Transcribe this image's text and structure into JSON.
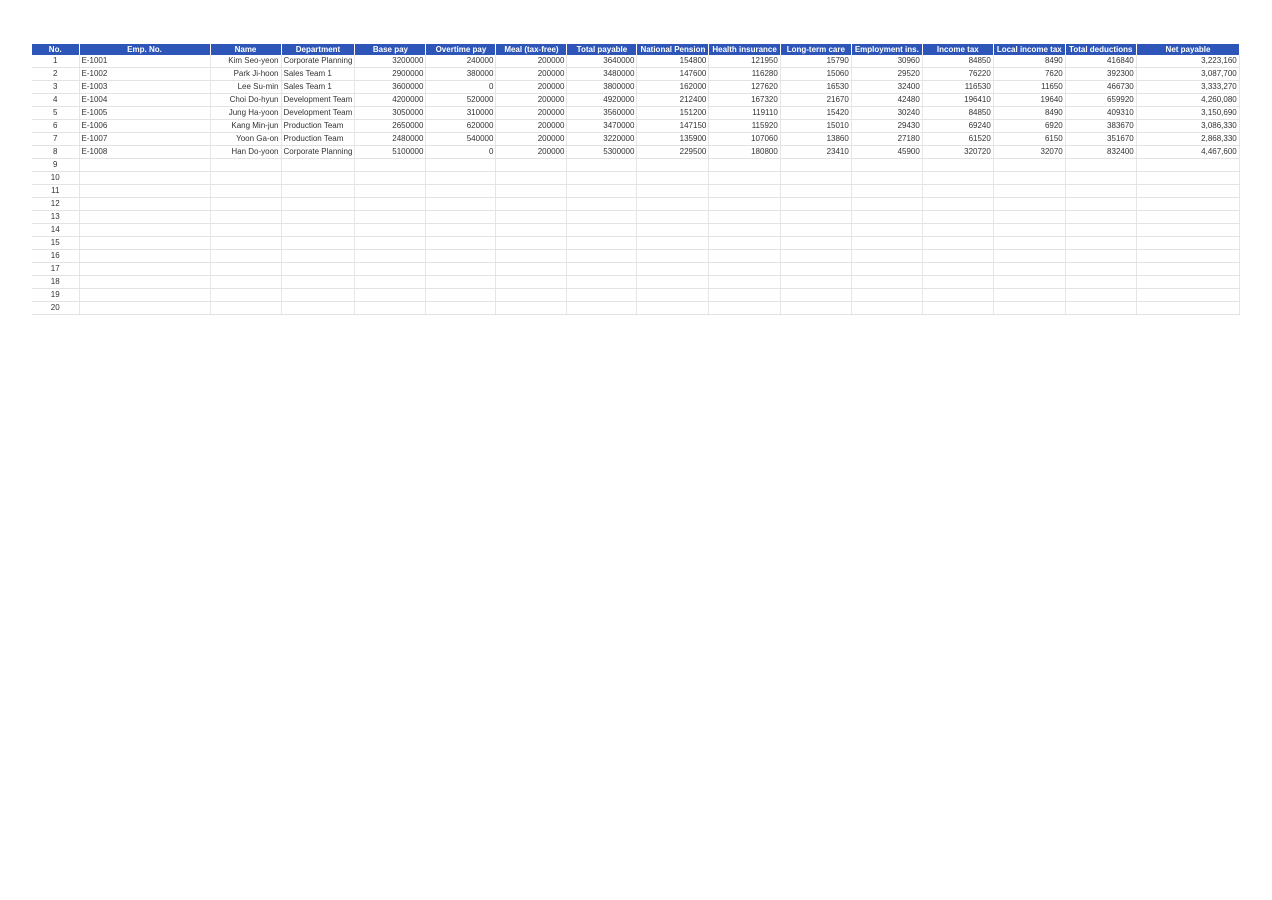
{
  "columns": [
    {
      "key": "no",
      "label": "No.",
      "align": "center",
      "width": 47
    },
    {
      "key": "emp",
      "label": "Emp. No.",
      "align": "left",
      "width": 131
    },
    {
      "key": "name",
      "label": "Name",
      "align": "right",
      "width": 71
    },
    {
      "key": "dept",
      "label": "Department",
      "align": "left",
      "width": 70
    },
    {
      "key": "base",
      "label": "Base pay",
      "align": "right",
      "width": 71
    },
    {
      "key": "ot",
      "label": "Overtime pay",
      "align": "right",
      "width": 70
    },
    {
      "key": "meal",
      "label": "Meal (tax-free)",
      "align": "right",
      "width": 71
    },
    {
      "key": "total",
      "label": "Total payable",
      "align": "right",
      "width": 70
    },
    {
      "key": "pension",
      "label": "National Pension",
      "align": "right",
      "width": 71
    },
    {
      "key": "health",
      "label": "Health insurance",
      "align": "right",
      "width": 70
    },
    {
      "key": "ltc",
      "label": "Long-term care",
      "align": "right",
      "width": 71
    },
    {
      "key": "emp_ins",
      "label": "Employment ins.",
      "align": "right",
      "width": 70
    },
    {
      "key": "itax",
      "label": "Income tax",
      "align": "right",
      "width": 71
    },
    {
      "key": "ltax",
      "label": "Local income tax",
      "align": "right",
      "width": 70
    },
    {
      "key": "deduct",
      "label": "Total deductions",
      "align": "right",
      "width": 71
    },
    {
      "key": "net",
      "label": "Net payable",
      "align": "right",
      "width": 103
    }
  ],
  "rows": [
    [
      "1",
      "E-1001",
      "Kim Seo-yeon",
      "Corporate Planning",
      "3200000",
      "240000",
      "200000",
      "3640000",
      "154800",
      "121950",
      "15790",
      "30960",
      "84850",
      "8490",
      "416840",
      "3,223,160"
    ],
    [
      "2",
      "E-1002",
      "Park Ji-hoon",
      "Sales Team 1",
      "2900000",
      "380000",
      "200000",
      "3480000",
      "147600",
      "116280",
      "15060",
      "29520",
      "76220",
      "7620",
      "392300",
      "3,087,700"
    ],
    [
      "3",
      "E-1003",
      "Lee Su-min",
      "Sales Team 1",
      "3600000",
      "0",
      "200000",
      "3800000",
      "162000",
      "127620",
      "16530",
      "32400",
      "116530",
      "11650",
      "466730",
      "3,333,270"
    ],
    [
      "4",
      "E-1004",
      "Choi Do-hyun",
      "Development Team",
      "4200000",
      "520000",
      "200000",
      "4920000",
      "212400",
      "167320",
      "21670",
      "42480",
      "196410",
      "19640",
      "659920",
      "4,260,080"
    ],
    [
      "5",
      "E-1005",
      "Jung Ha-yoon",
      "Development Team",
      "3050000",
      "310000",
      "200000",
      "3560000",
      "151200",
      "119110",
      "15420",
      "30240",
      "84850",
      "8490",
      "409310",
      "3,150,690"
    ],
    [
      "6",
      "E-1006",
      "Kang Min-jun",
      "Production Team",
      "2650000",
      "620000",
      "200000",
      "3470000",
      "147150",
      "115920",
      "15010",
      "29430",
      "69240",
      "6920",
      "383670",
      "3,086,330"
    ],
    [
      "7",
      "E-1007",
      "Yoon Ga-on",
      "Production Team",
      "2480000",
      "540000",
      "200000",
      "3220000",
      "135900",
      "107060",
      "13860",
      "27180",
      "61520",
      "6150",
      "351670",
      "2,868,330"
    ],
    [
      "8",
      "E-1008",
      "Han Do-yoon",
      "Corporate Planning",
      "5100000",
      "0",
      "200000",
      "5300000",
      "229500",
      "180800",
      "23410",
      "45900",
      "320720",
      "32070",
      "832400",
      "4,467,600"
    ],
    [
      "9",
      "",
      "",
      "",
      "",
      "",
      "",
      "",
      "",
      "",
      "",
      "",
      "",
      "",
      "",
      ""
    ],
    [
      "10",
      "",
      "",
      "",
      "",
      "",
      "",
      "",
      "",
      "",
      "",
      "",
      "",
      "",
      "",
      ""
    ],
    [
      "11",
      "",
      "",
      "",
      "",
      "",
      "",
      "",
      "",
      "",
      "",
      "",
      "",
      "",
      "",
      ""
    ],
    [
      "12",
      "",
      "",
      "",
      "",
      "",
      "",
      "",
      "",
      "",
      "",
      "",
      "",
      "",
      "",
      ""
    ],
    [
      "13",
      "",
      "",
      "",
      "",
      "",
      "",
      "",
      "",
      "",
      "",
      "",
      "",
      "",
      "",
      ""
    ],
    [
      "14",
      "",
      "",
      "",
      "",
      "",
      "",
      "",
      "",
      "",
      "",
      "",
      "",
      "",
      "",
      ""
    ],
    [
      "15",
      "",
      "",
      "",
      "",
      "",
      "",
      "",
      "",
      "",
      "",
      "",
      "",
      "",
      "",
      ""
    ],
    [
      "16",
      "",
      "",
      "",
      "",
      "",
      "",
      "",
      "",
      "",
      "",
      "",
      "",
      "",
      "",
      ""
    ],
    [
      "17",
      "",
      "",
      "",
      "",
      "",
      "",
      "",
      "",
      "",
      "",
      "",
      "",
      "",
      "",
      ""
    ],
    [
      "18",
      "",
      "",
      "",
      "",
      "",
      "",
      "",
      "",
      "",
      "",
      "",
      "",
      "",
      "",
      ""
    ],
    [
      "19",
      "",
      "",
      "",
      "",
      "",
      "",
      "",
      "",
      "",
      "",
      "",
      "",
      "",
      "",
      ""
    ],
    [
      "20",
      "",
      "",
      "",
      "",
      "",
      "",
      "",
      "",
      "",
      "",
      "",
      "",
      "",
      "",
      ""
    ]
  ],
  "colors": {
    "header_bg": "#2e56b8",
    "header_text": "#ffffff",
    "grid": "#e3e3e3",
    "text": "#333333"
  }
}
